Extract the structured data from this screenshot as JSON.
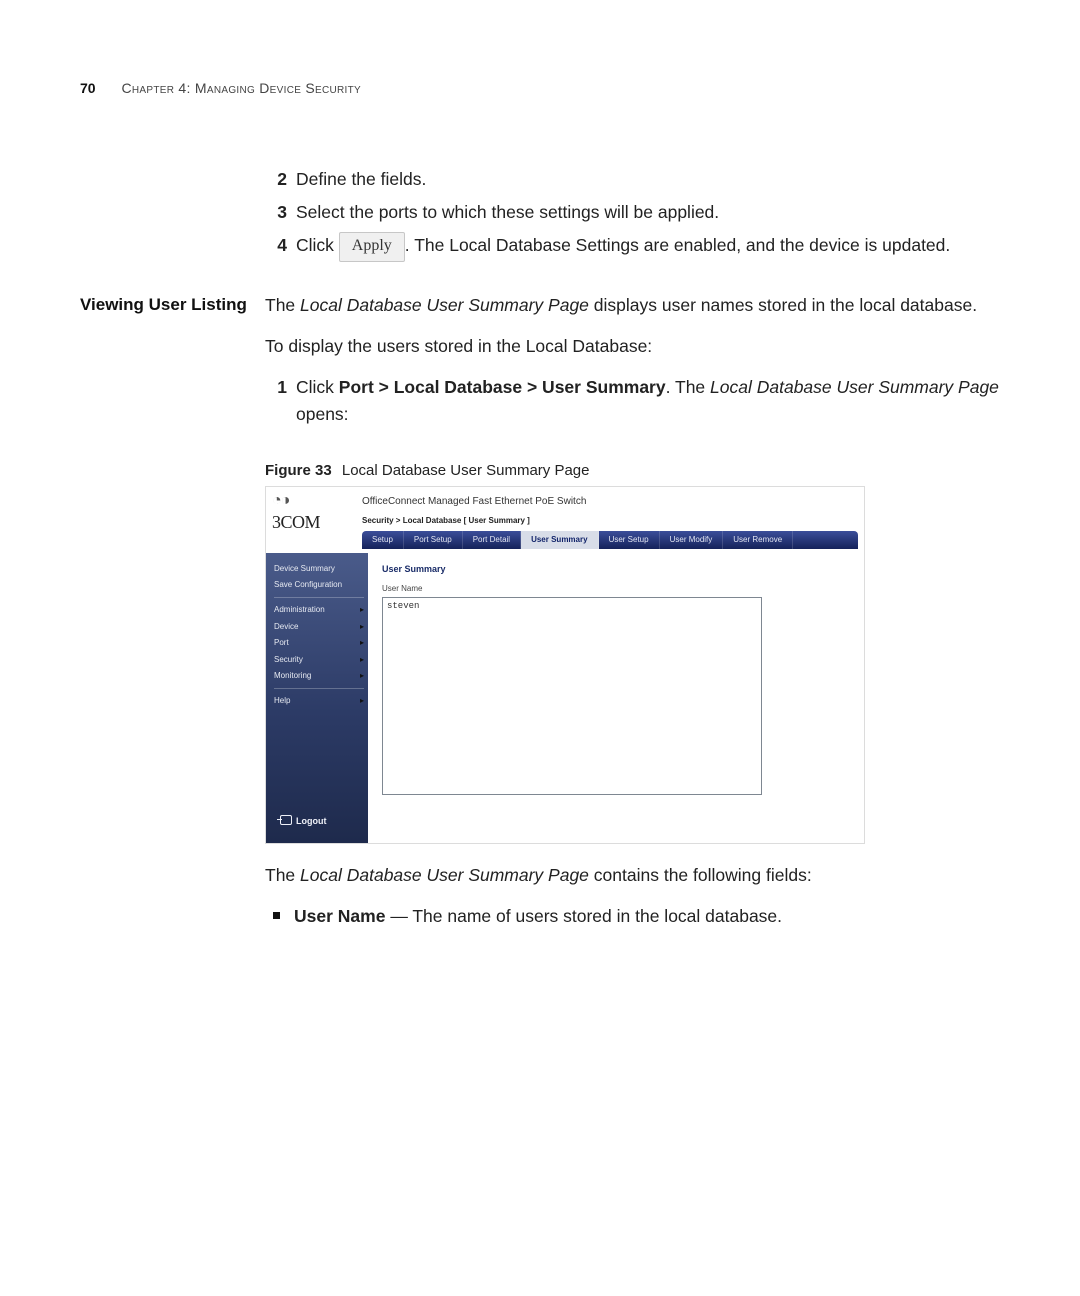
{
  "header": {
    "page_number": "70",
    "chapter_label": "Chapter 4: Managing Device Security"
  },
  "steps_a": [
    {
      "n": "2",
      "text": "Define the fields."
    },
    {
      "n": "3",
      "text": "Select the ports to which these settings will be applied."
    }
  ],
  "step4": {
    "n": "4",
    "lead": "Click ",
    "button": " Apply ",
    "mid": ". The Local Database Settings are enabled, and the device is updated."
  },
  "section": {
    "side_title": "Viewing User Listing",
    "p1_a": "The ",
    "p1_i": "Local Database User Summary Page",
    "p1_b": " displays user names stored in the local database.",
    "p2": "To display the users stored in the Local Database:"
  },
  "step_b1": {
    "n": "1",
    "lead": "Click ",
    "nav": "Port > Local Database > User Summary",
    "mid": ". The ",
    "ital": "Local Database User Summary Page",
    "tail": " opens:"
  },
  "figure": {
    "label": "Figure 33",
    "caption": "Local Database User Summary Page",
    "brand_glyph": "◔◑",
    "brand_name": "3COM",
    "product_title": "OfficeConnect Managed Fast Ethernet PoE Switch",
    "breadcrumb": "Security > Local Database [ User Summary ]",
    "tabs": [
      "Setup",
      "Port Setup",
      "Port Detail",
      "User Summary",
      "User Setup",
      "User Modify",
      "User Remove"
    ],
    "active_tab_index": 3,
    "side_top": [
      "Device Summary",
      "Save Configuration"
    ],
    "side_nav": [
      "Administration",
      "Device",
      "Port",
      "Security",
      "Monitoring"
    ],
    "side_help": "Help",
    "logout": "Logout",
    "content_title": "User Summary",
    "column_header": "User Name",
    "list_values": [
      "steven"
    ]
  },
  "after": {
    "p_a": "The ",
    "p_i": "Local Database User Summary Page",
    "p_b": " contains the following fields:",
    "bullet_term": "User Name",
    "bullet_rest": " — The name of users stored in the local database."
  }
}
